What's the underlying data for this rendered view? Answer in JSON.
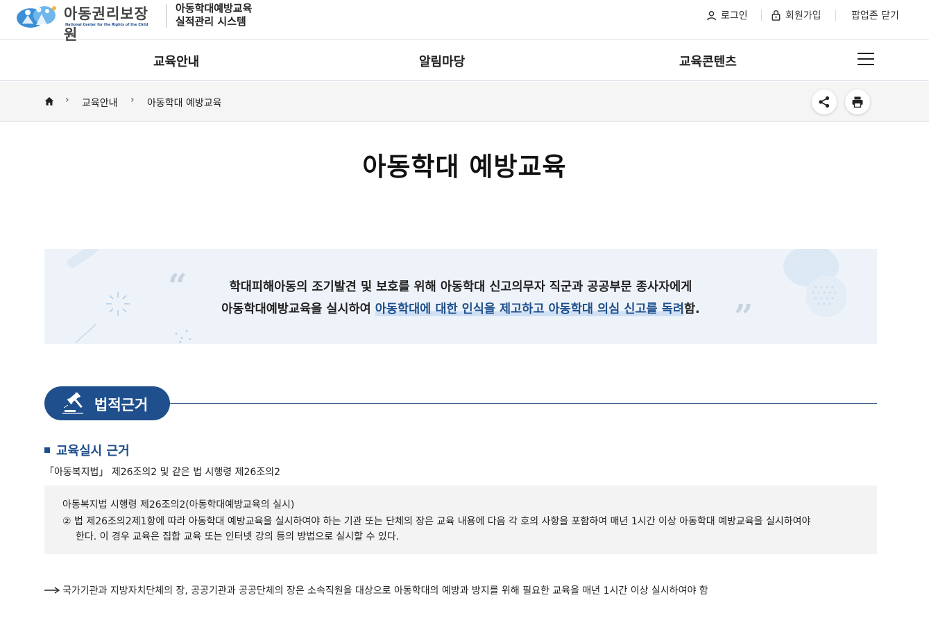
{
  "header": {
    "logo": {
      "name": "아동권리보장원",
      "subtitle": "National Center for the Rights of the Child"
    },
    "system_title": [
      "아동학대예방교육",
      "실적관리 시스템"
    ],
    "util_links": {
      "login": "로그인",
      "join": "회원가입",
      "popup_close": "팝업존 닫기"
    }
  },
  "gnb": {
    "items": [
      "교육안내",
      "알림마당",
      "교육콘텐츠"
    ],
    "menu_icon": "hamburger-icon"
  },
  "breadcrumb": {
    "home_icon": "home-icon",
    "items": [
      "교육안내",
      "아동학대 예방교육"
    ],
    "actions": [
      "share-icon",
      "print-icon"
    ]
  },
  "page": {
    "title": "아동학대 예방교육"
  },
  "quote": {
    "line1": "학대피해아동의 조기발견 및 보호를 위해 아동학대 신고의무자 직군과 공공부문 종사자에게",
    "line2_prefix": "아동학대예방교육을 실시하여 ",
    "line2_highlight": "아동학대에 대한 인식을 제고하고 아동학대 의심 신고를 독려",
    "line2_suffix": "함."
  },
  "section": {
    "title": "법적근거",
    "icon": "gavel-icon",
    "sub_heading": "교육실시 근거",
    "basis": "「아동복지법」 제26조의2 및 같은 법 시행령 제26조의2",
    "law_box": {
      "title": "아동복지법 시행령 제26조의2(아동학대예방교육의 실시)",
      "line1": "② 법 제26조의2제1항에 따라 아동학대 예방교육을 실시하여야 하는 기관 또는 단체의 장은 교육 내용에 다음 각 호의 사항을 포함하여 매년 1시간 이상 아동학대 예방교육을 실시하여야",
      "line2": "한다. 이 경우 교육은 집합 교육 또는 인터넷 강의 등의 방법으로 실시할 수 있다."
    },
    "note": "국가기관과 지방자치단체의 장, 공공기관과 공공단체의 장은 소속직원을 대상으로 아동학대의 예방과 방지를 위해 필요한 교육을 매년 1시간 이상 실시하여야 함"
  },
  "colors": {
    "primary": "#1f4f8c",
    "quote_bg": "#eef3f9",
    "law_bg": "#f3f3f3"
  }
}
